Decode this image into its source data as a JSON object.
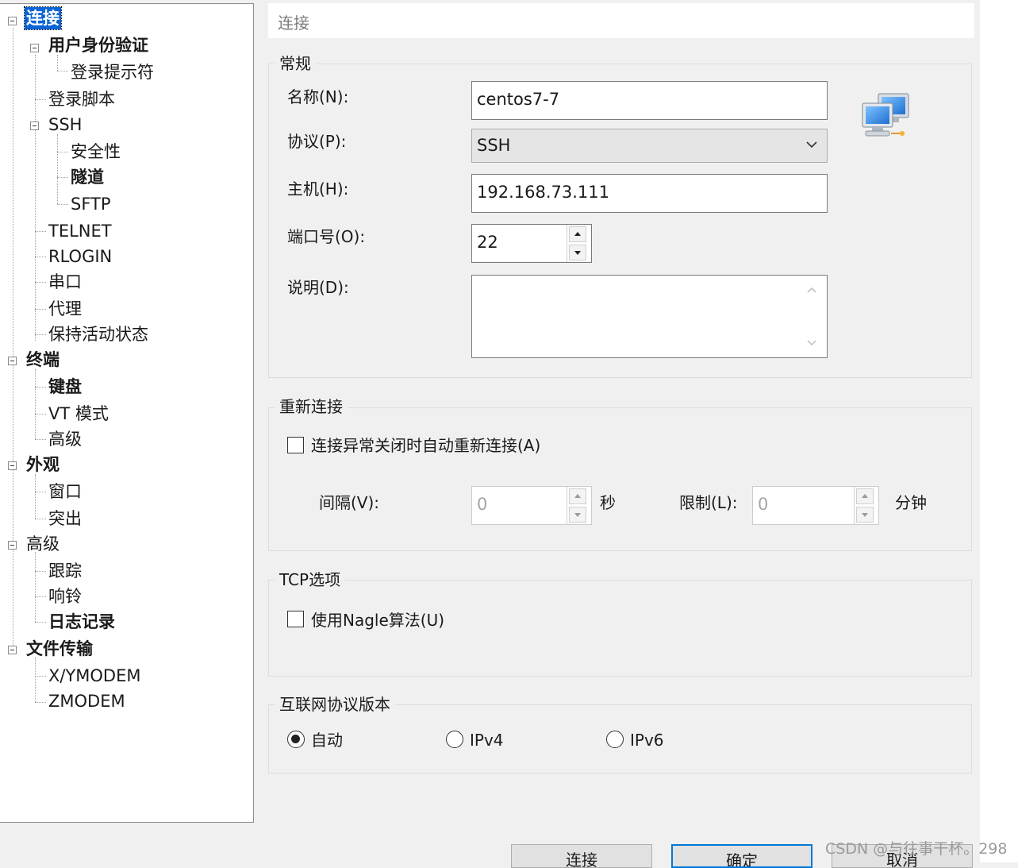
{
  "tree": {
    "nodes": [
      {
        "label": "连接"
      },
      {
        "label": "用户身份验证"
      },
      {
        "label": "登录提示符"
      },
      {
        "label": "登录脚本"
      },
      {
        "label": "SSH"
      },
      {
        "label": "安全性"
      },
      {
        "label": "隧道"
      },
      {
        "label": "SFTP"
      },
      {
        "label": "TELNET"
      },
      {
        "label": "RLOGIN"
      },
      {
        "label": "串口"
      },
      {
        "label": "代理"
      },
      {
        "label": "保持活动状态"
      },
      {
        "label": "终端"
      },
      {
        "label": "键盘"
      },
      {
        "label": "VT 模式"
      },
      {
        "label": "高级"
      },
      {
        "label": "外观"
      },
      {
        "label": "窗口"
      },
      {
        "label": "突出"
      },
      {
        "label": "高级"
      },
      {
        "label": "跟踪"
      },
      {
        "label": "响铃"
      },
      {
        "label": "日志记录"
      },
      {
        "label": "文件传输"
      },
      {
        "label": "X/YMODEM"
      },
      {
        "label": "ZMODEM"
      }
    ]
  },
  "header": {
    "title": "连接"
  },
  "general": {
    "group_label": "常规",
    "name_label": "名称(N):",
    "name_value": "centos7-7",
    "protocol_label": "协议(P):",
    "protocol_value": "SSH",
    "host_label": "主机(H):",
    "host_value": "192.168.73.111",
    "port_label": "端口号(O):",
    "port_value": "22",
    "desc_label": "说明(D):",
    "desc_value": ""
  },
  "reconnect": {
    "group_label": "重新连接",
    "checkbox_label": "连接异常关闭时自动重新连接(A)",
    "interval_label": "间隔(V):",
    "interval_value": "0",
    "interval_unit": "秒",
    "limit_label": "限制(L):",
    "limit_value": "0",
    "limit_unit": "分钟"
  },
  "tcp": {
    "group_label": "TCP选项",
    "nagle_label": "使用Nagle算法(U)"
  },
  "ip": {
    "group_label": "互联网协议版本",
    "auto_label": "自动",
    "ipv4_label": "IPv4",
    "ipv6_label": "IPv6",
    "selected": "自动"
  },
  "buttons": {
    "connect": "连接",
    "ok": "确定",
    "cancel": "取消"
  },
  "watermark": "CSDN @与往事干杯。298"
}
